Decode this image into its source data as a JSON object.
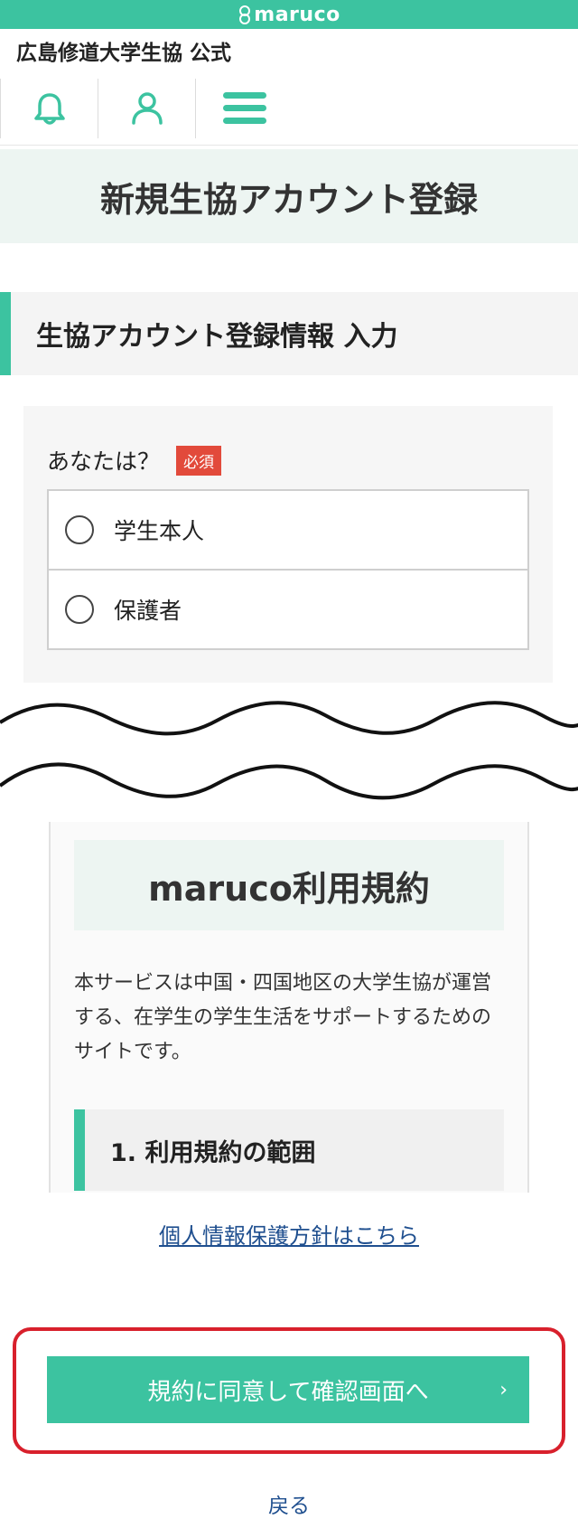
{
  "topbar": {
    "brand": "maruco"
  },
  "header": {
    "site_title": "広島修道大学生協 公式"
  },
  "icons": {
    "notification": "bell-icon",
    "account": "user-icon",
    "menu": "hamburger-menu-icon",
    "brand": "maruco-logo-icon"
  },
  "page": {
    "title": "新規生協アカウント登録"
  },
  "section": {
    "title": "生協アカウント登録情報 入力"
  },
  "form": {
    "question": "あなたは？",
    "required_badge": "必須",
    "options": [
      {
        "label": "学生本人"
      },
      {
        "label": "保護者"
      }
    ]
  },
  "terms": {
    "title": "maruco利用規約",
    "intro": "本サービスは中国・四国地区の大学生協が運営する、在学生の学生生活をサポートするためのサイトです。",
    "section_1": "1. 利用規約の範囲"
  },
  "links": {
    "privacy": "個人情報保護方針はこちら"
  },
  "actions": {
    "agree_button": "規約に同意して確認画面へ",
    "chevron": "›",
    "back": "戻る"
  },
  "colors": {
    "accent": "#3cc3a0",
    "required": "#e24a3b",
    "highlight_frame": "#d8202c",
    "link": "#1f4f8f"
  }
}
